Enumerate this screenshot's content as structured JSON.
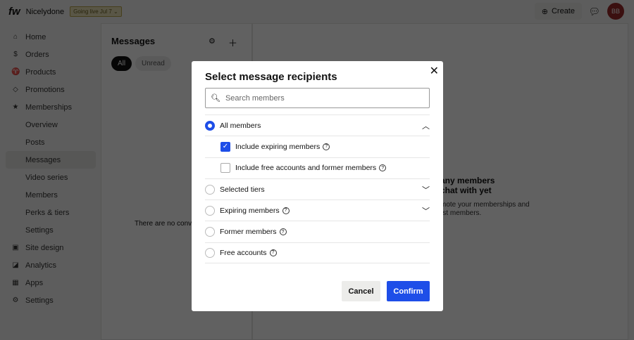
{
  "header": {
    "logo": "fw",
    "brand": "Nicelydone",
    "badge": "Going live Jul 7",
    "create": "Create",
    "avatar": "BB"
  },
  "sidebar": {
    "items": [
      {
        "label": "Home",
        "icon": "⌂",
        "sub": false
      },
      {
        "label": "Orders",
        "icon": "$",
        "sub": false
      },
      {
        "label": "Products",
        "icon": "♈",
        "sub": false
      },
      {
        "label": "Promotions",
        "icon": "◇",
        "sub": false
      },
      {
        "label": "Memberships",
        "icon": "★",
        "sub": false
      },
      {
        "label": "Overview",
        "sub": true
      },
      {
        "label": "Posts",
        "sub": true
      },
      {
        "label": "Messages",
        "sub": true,
        "active": true
      },
      {
        "label": "Video series",
        "sub": true
      },
      {
        "label": "Members",
        "sub": true
      },
      {
        "label": "Perks & tiers",
        "sub": true
      },
      {
        "label": "Settings",
        "sub": true
      },
      {
        "label": "Site design",
        "icon": "▣",
        "sub": false
      },
      {
        "label": "Analytics",
        "icon": "◪",
        "sub": false
      },
      {
        "label": "Apps",
        "icon": "▦",
        "sub": false
      },
      {
        "label": "Settings",
        "icon": "⚙",
        "sub": false
      }
    ]
  },
  "messages": {
    "title": "Messages",
    "tabs": [
      "All",
      "Unread"
    ],
    "empty": "There are no conve"
  },
  "main": {
    "title1": "any members",
    "title2": "chat with yet",
    "sub1": "mote your memberships and",
    "sub2": "rst members."
  },
  "modal": {
    "title": "Select message recipients",
    "search_placeholder": "Search members",
    "options": {
      "all": "All members",
      "expiring_inc": "Include expiring members",
      "free_inc": "Include free accounts and former members",
      "tiers": "Selected tiers",
      "expiring": "Expiring members",
      "former": "Former members",
      "free": "Free accounts"
    },
    "cancel": "Cancel",
    "confirm": "Confirm"
  }
}
